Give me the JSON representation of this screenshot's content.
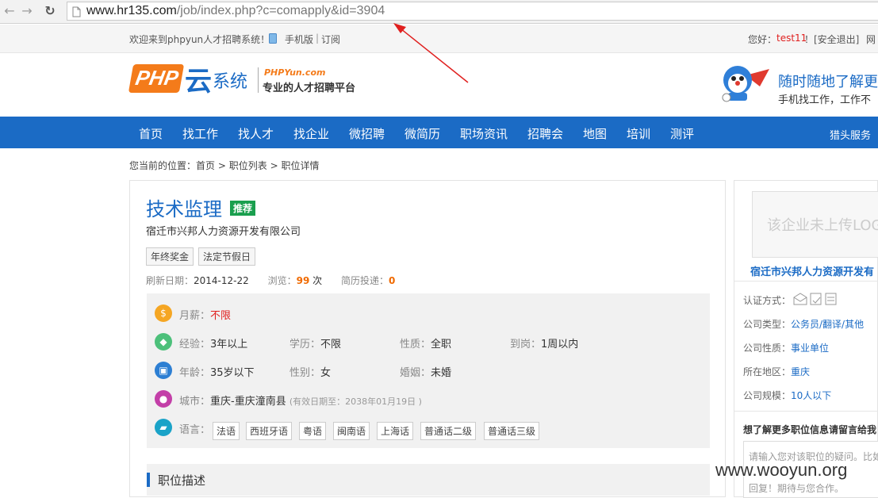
{
  "browser": {
    "url_host": "www.hr135.com",
    "url_path": "/job/index.php?c=comapply&id=3904"
  },
  "topbar": {
    "welcome": "欢迎来到phpyun人才招聘系统！",
    "mobile": "手机版",
    "subscribe": "订阅",
    "greeting": "您好：",
    "username": "test11",
    "logout": "！[安全退出]",
    "right_cut": "网"
  },
  "header": {
    "logo_php": "PHP",
    "logo_yun": "云",
    "logo_system": "系统",
    "logo_site": "PHPYun.com",
    "logo_slogan": "专业的人才招聘平台",
    "promo_title": "随时随地了解更",
    "promo_sub": "手机找工作，工作不"
  },
  "nav": {
    "items": [
      "首页",
      "找工作",
      "找人才",
      "找企业",
      "微招聘",
      "微简历",
      "职场资讯",
      "招聘会",
      "地图",
      "培训",
      "测评"
    ],
    "right": "猎头服务"
  },
  "breadcrumb": {
    "prefix": "您当前的位置：",
    "home": "首页",
    "list": "职位列表",
    "detail": "职位详情",
    "sep": ">"
  },
  "job": {
    "title": "技术监理",
    "badge": "推荐",
    "company": "宿迁市兴邦人力资源开发有限公司",
    "benefits": [
      "年终奖金",
      "法定节假日"
    ],
    "refresh_label": "刷新日期：",
    "refresh_date": "2014-12-22",
    "views_label": "浏览：",
    "views": "99",
    "views_unit": "次",
    "resumes_label": "简历投递：",
    "resumes": "0",
    "salary_label": "月薪：",
    "salary": "不限",
    "exp_label": "经验：",
    "exp": "3年以上",
    "edu_label": "学历：",
    "edu": "不限",
    "nature_label": "性质：",
    "nature": "全职",
    "arrive_label": "到岗：",
    "arrive": "1周以内",
    "age_label": "年龄：",
    "age": "35岁以下",
    "gender_label": "性别：",
    "gender": "女",
    "marriage_label": "婚姻：",
    "marriage": "未婚",
    "city_label": "城市：",
    "city": "重庆-重庆潼南县",
    "valid": "(有效日期至：2038年01月19日 )",
    "lang_label": "语言：",
    "languages": [
      "法语",
      "西班牙语",
      "粤语",
      "闽南语",
      "上海话",
      "普通话二级",
      "普通话三级"
    ],
    "desc_heading": "职位描述"
  },
  "sidebar": {
    "logo_placeholder": "该企业未上传LOG",
    "company": "宿迁市兴邦人力资源开发有",
    "auth_label": "认证方式：",
    "type_label": "公司类型：",
    "type": "公务员/翻译/其他",
    "nature_label": "公司性质：",
    "nature": "事业单位",
    "region_label": "所在地区：",
    "region": "重庆",
    "size_label": "公司规模：",
    "size": "10人以下",
    "msg_heading": "想了解更多职位信息请留言给我",
    "msg_placeholder": "请输入您对该职位的疑问。比如",
    "msg_line3": "回复！期待与您合作。"
  },
  "watermark": "www.wooyun.org",
  "colors": {
    "nav_blue": "#1b6bc5",
    "title_blue": "#1b6bc5",
    "red": "#e0201f",
    "orange": "#f06a00"
  }
}
